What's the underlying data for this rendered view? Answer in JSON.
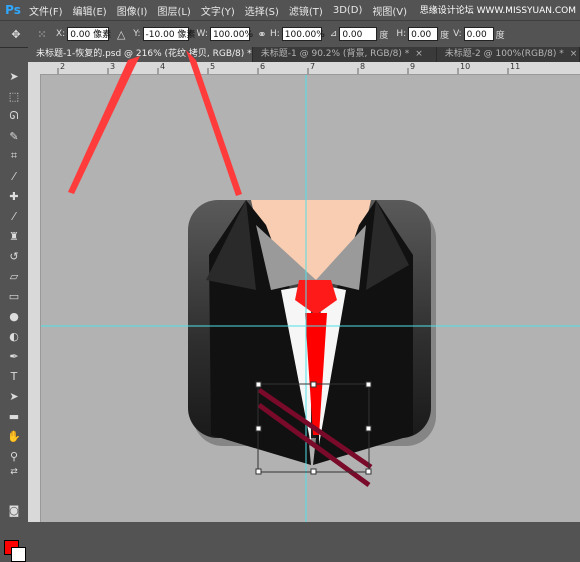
{
  "app": {
    "logo": "Ps"
  },
  "menu": [
    "文件(F)",
    "编辑(E)",
    "图像(I)",
    "图层(L)",
    "文字(Y)",
    "选择(S)",
    "滤镜(T)",
    "3D(D)",
    "视图(V)"
  ],
  "watermark": "思缘设计论坛 WWW.MISSYUAN.COM",
  "options": {
    "x_label": "X:",
    "x_value": "0.00 像素",
    "y_label": "Y:",
    "y_value": "-10.00 像素",
    "w_label": "W:",
    "w_value": "100.00%",
    "h_label": "H:",
    "h_value": "100.00%",
    "angle_value": "0.00",
    "angle_unit": "度",
    "hskew_label": "H:",
    "hskew_value": "0.00",
    "hskew_unit": "度",
    "vskew_label": "V:",
    "vskew_value": "0.00",
    "vskew_unit": "度"
  },
  "tabs": [
    {
      "title": "未标题-1-恢复的.psd @ 216% (花纹 拷贝, RGB/8) *",
      "close": "×"
    },
    {
      "title": "未标题-1 @ 90.2% (背景, RGB/8) *",
      "close": "×"
    },
    {
      "title": "未标题-2 @ 100%(RGB/8) *",
      "close": "×"
    }
  ],
  "ruler_ticks": [
    "2",
    "3",
    "4",
    "5",
    "6",
    "7",
    "8",
    "9",
    "10",
    "11"
  ],
  "colors": {
    "foreground": "#ff0000",
    "background": "#ffffff",
    "guide": "#4ee0e6",
    "annotation_arrow": "#ff3b3b"
  },
  "tools": [
    "move-tool-icon",
    "marquee-tool-icon",
    "lasso-tool-icon",
    "quick-select-tool-icon",
    "crop-tool-icon",
    "eyedropper-tool-icon",
    "healing-brush-tool-icon",
    "brush-tool-icon",
    "stamp-tool-icon",
    "history-brush-tool-icon",
    "eraser-tool-icon",
    "gradient-tool-icon",
    "blur-tool-icon",
    "dodge-tool-icon",
    "pen-tool-icon",
    "type-tool-icon",
    "path-select-tool-icon",
    "shape-tool-icon",
    "hand-tool-icon",
    "zoom-tool-icon"
  ]
}
